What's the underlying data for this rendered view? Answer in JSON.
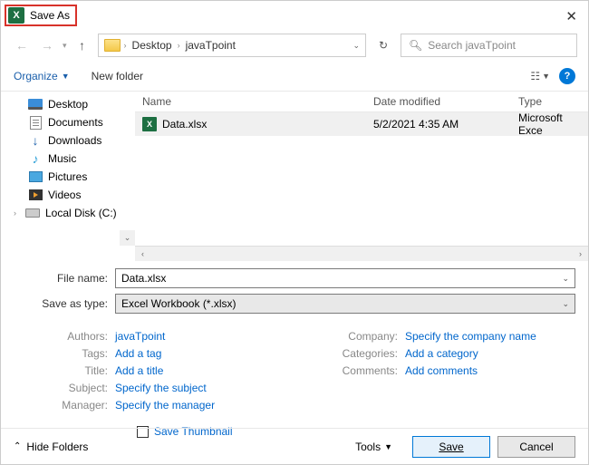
{
  "title": "Save As",
  "breadcrumbs": [
    "Desktop",
    "javaTpoint"
  ],
  "search_placeholder": "Search javaTpoint",
  "toolbar": {
    "organize": "Organize",
    "new_folder": "New folder"
  },
  "tree": [
    {
      "label": "Desktop",
      "icon": "desktop"
    },
    {
      "label": "Documents",
      "icon": "docs"
    },
    {
      "label": "Downloads",
      "icon": "downloads"
    },
    {
      "label": "Music",
      "icon": "music"
    },
    {
      "label": "Pictures",
      "icon": "pictures"
    },
    {
      "label": "Videos",
      "icon": "videos"
    },
    {
      "label": "Local Disk (C:)",
      "icon": "disk"
    }
  ],
  "columns": {
    "name": "Name",
    "date": "Date modified",
    "type": "Type"
  },
  "files": [
    {
      "name": "Data.xlsx",
      "date": "5/2/2021 4:35 AM",
      "type": "Microsoft Exce"
    }
  ],
  "form": {
    "filename_label": "File name:",
    "filename_value": "Data.xlsx",
    "savetype_label": "Save as type:",
    "savetype_value": "Excel Workbook (*.xlsx)"
  },
  "meta_left": [
    {
      "label": "Authors:",
      "value": "javaTpoint"
    },
    {
      "label": "Tags:",
      "value": "Add a tag"
    },
    {
      "label": "Title:",
      "value": "Add a title"
    },
    {
      "label": "Subject:",
      "value": "Specify the subject"
    },
    {
      "label": "Manager:",
      "value": "Specify the manager"
    }
  ],
  "meta_right": [
    {
      "label": "Company:",
      "value": "Specify the company name"
    },
    {
      "label": "Categories:",
      "value": "Add a category"
    },
    {
      "label": "Comments:",
      "value": "Add comments"
    }
  ],
  "thumbnail_label": "Save Thumbnail",
  "bottom": {
    "hide_folders": "Hide Folders",
    "tools": "Tools",
    "save": "Save",
    "cancel": "Cancel"
  }
}
